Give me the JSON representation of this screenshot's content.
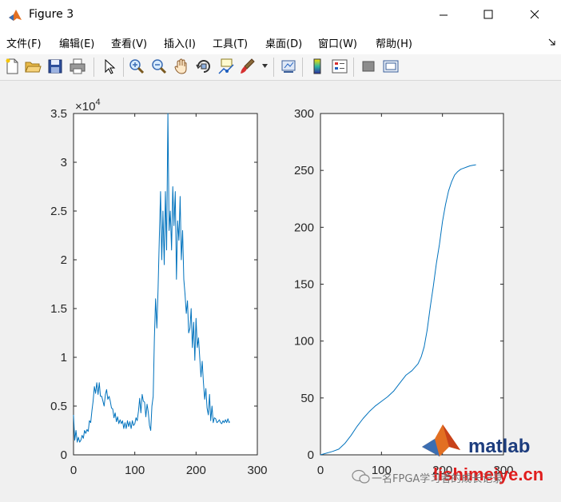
{
  "window": {
    "title": "Figure 3",
    "icon": "matlab-logo-icon"
  },
  "menu": [
    "文件(F)",
    "编辑(E)",
    "查看(V)",
    "插入(I)",
    "工具(T)",
    "桌面(D)",
    "窗口(W)",
    "帮助(H)"
  ],
  "toolbar": [
    "new-figure-icon",
    "open-folder-icon",
    "save-icon",
    "print-icon",
    "pointer-icon",
    "zoom-in-icon",
    "zoom-out-icon",
    "pan-hand-icon",
    "rotate-3d-icon",
    "data-cursor-icon",
    "brush-icon",
    "link-icon",
    "colorbar-icon",
    "legend-icon",
    "hide-plot-tools-icon",
    "show-plot-tools-icon"
  ],
  "chart_data": [
    {
      "type": "line",
      "title": "",
      "xlabel": "",
      "ylabel": "",
      "xlim": [
        0,
        300
      ],
      "ylim": [
        0,
        35000
      ],
      "xticks": [
        "0",
        "100",
        "200",
        "300"
      ],
      "yticks": [
        "0",
        "0.5",
        "1",
        "1.5",
        "2",
        "2.5",
        "3",
        "3.5"
      ],
      "exponent_label": "×10",
      "exponent_power": "4",
      "color": "#0072bd",
      "series": [
        {
          "x": [
            0,
            2,
            4,
            6,
            8,
            10,
            12,
            14,
            16,
            18,
            20,
            22,
            24,
            26,
            28,
            30,
            32,
            34,
            36,
            38,
            40,
            42,
            44,
            46,
            48,
            50,
            52,
            54,
            56,
            58,
            60,
            62,
            64,
            66,
            68,
            70,
            72,
            74,
            76,
            78,
            80,
            82,
            84,
            86,
            88,
            90,
            92,
            94,
            96,
            98,
            100,
            102,
            104,
            106,
            108,
            110,
            112,
            114,
            116,
            118,
            120,
            122,
            124,
            126,
            128,
            130,
            132,
            134,
            136,
            138,
            140,
            142,
            144,
            146,
            148,
            150,
            152,
            154,
            156,
            158,
            160,
            162,
            164,
            166,
            168,
            170,
            172,
            174,
            176,
            178,
            180,
            182,
            184,
            186,
            188,
            190,
            192,
            194,
            196,
            198,
            200,
            202,
            204,
            206,
            208,
            210,
            212,
            214,
            216,
            218,
            220,
            222,
            224,
            226,
            228,
            230,
            232,
            234,
            236,
            238,
            240,
            242,
            244,
            246,
            248,
            250,
            252,
            254,
            255
          ],
          "y": [
            4100,
            1500,
            2500,
            1300,
            1800,
            1300,
            1500,
            2000,
            1700,
            2500,
            2200,
            2600,
            2400,
            3500,
            3300,
            4500,
            5500,
            7000,
            6300,
            7400,
            6200,
            7400,
            6000,
            6000,
            5500,
            5000,
            6200,
            6700,
            5700,
            6000,
            5500,
            4800,
            4700,
            3800,
            4300,
            3400,
            3900,
            3200,
            3600,
            3200,
            3500,
            2700,
            3300,
            2700,
            3500,
            2900,
            3400,
            2700,
            3500,
            3000,
            3200,
            3800,
            3500,
            4500,
            5800,
            4300,
            6200,
            5500,
            5400,
            3900,
            5200,
            4400,
            3000,
            2500,
            5000,
            6000,
            12000,
            16000,
            13000,
            17000,
            22000,
            27000,
            20000,
            25000,
            19500,
            27000,
            21000,
            35000,
            23000,
            25000,
            21000,
            27500,
            23500,
            27000,
            18000,
            24000,
            22000,
            26500,
            20000,
            23000,
            18000,
            16500,
            14500,
            15800,
            12500,
            13000,
            15000,
            11000,
            13600,
            9700,
            14000,
            11000,
            12000,
            10000,
            8000,
            9600,
            7500,
            5700,
            6800,
            4800,
            4100,
            6200,
            3500,
            5000,
            3300,
            3800,
            3700,
            3300,
            3400,
            3600,
            3300,
            3200,
            3500,
            3300,
            3600,
            3300,
            3700,
            3300,
            3400
          ]
        }
      ]
    },
    {
      "type": "line",
      "title": "",
      "xlabel": "",
      "ylabel": "",
      "xlim": [
        0,
        300
      ],
      "ylim": [
        0,
        300
      ],
      "xticks": [
        "0",
        "100",
        "200",
        "300"
      ],
      "yticks": [
        "0",
        "50",
        "100",
        "150",
        "200",
        "250",
        "300"
      ],
      "color": "#0072bd",
      "series": [
        {
          "x": [
            0,
            20,
            30,
            40,
            50,
            60,
            70,
            80,
            90,
            100,
            110,
            120,
            130,
            140,
            150,
            160,
            165,
            170,
            175,
            180,
            185,
            190,
            195,
            200,
            205,
            210,
            215,
            220,
            225,
            230,
            235,
            240,
            245,
            250,
            255
          ],
          "y": [
            0,
            3,
            5,
            10,
            17,
            25,
            32,
            38,
            43,
            47,
            51,
            56,
            63,
            70,
            74,
            80,
            86,
            95,
            110,
            130,
            148,
            168,
            185,
            205,
            220,
            232,
            240,
            246,
            249,
            251,
            252,
            253,
            254,
            254.5,
            255
          ]
        }
      ]
    }
  ],
  "watermark": {
    "brand": "matlab",
    "site": "lishimeiye.cn",
    "caption": "一名FPGA学习者的成长记录"
  }
}
